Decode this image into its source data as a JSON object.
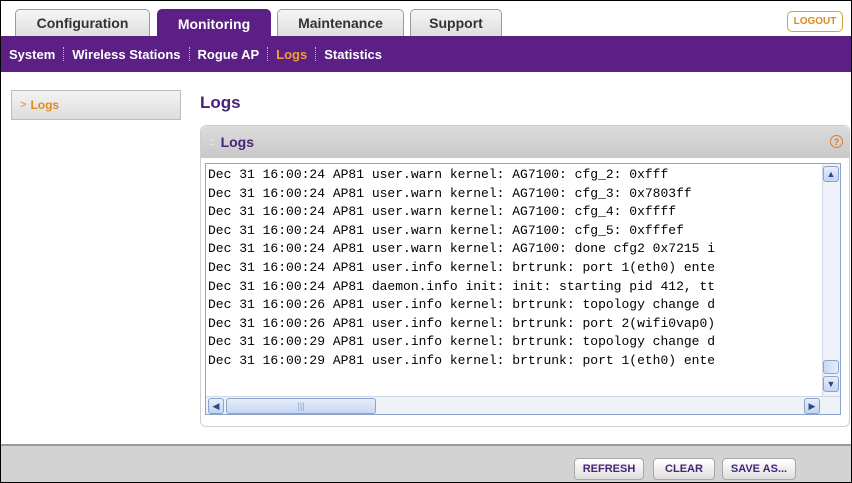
{
  "top_tabs": [
    {
      "label": "Configuration",
      "active": false
    },
    {
      "label": "Monitoring",
      "active": true
    },
    {
      "label": "Maintenance",
      "active": false
    },
    {
      "label": "Support",
      "active": false
    }
  ],
  "logout_label": "LOGOUT",
  "submenu": [
    {
      "label": "System",
      "active": false
    },
    {
      "label": "Wireless Stations",
      "active": false
    },
    {
      "label": "Rogue AP",
      "active": false
    },
    {
      "label": "Logs",
      "active": true
    },
    {
      "label": "Statistics",
      "active": false
    }
  ],
  "sidenav": {
    "arrow": ">",
    "label": "Logs"
  },
  "page_title": "Logs",
  "panel": {
    "dots": "::",
    "title": "Logs",
    "help": "?"
  },
  "log_lines": [
    "Dec 31 16:00:24 AP81 user.warn kernel: AG7100: cfg_2: 0xfff",
    "Dec 31 16:00:24 AP81 user.warn kernel: AG7100: cfg_3: 0x7803ff",
    "Dec 31 16:00:24 AP81 user.warn kernel: AG7100: cfg_4: 0xffff",
    "Dec 31 16:00:24 AP81 user.warn kernel: AG7100: cfg_5: 0xfffef",
    "Dec 31 16:00:24 AP81 user.warn kernel: AG7100: done cfg2 0x7215 i",
    "Dec 31 16:00:24 AP81 user.info kernel: brtrunk: port 1(eth0) ente",
    "Dec 31 16:00:24 AP81 daemon.info init: init: starting pid 412, tt",
    "Dec 31 16:00:26 AP81 user.info kernel: brtrunk: topology change d",
    "Dec 31 16:00:26 AP81 user.info kernel: brtrunk: port 2(wifi0vap0)",
    "Dec 31 16:00:29 AP81 user.info kernel: brtrunk: topology change d",
    "Dec 31 16:00:29 AP81 user.info kernel: brtrunk: port 1(eth0) ente"
  ],
  "footer_buttons": {
    "refresh": "REFRESH",
    "clear": "CLEAR",
    "save_as": "SAVE AS..."
  },
  "colors": {
    "brand_purple": "#5b1f86",
    "accent_orange": "#e08a1e"
  }
}
